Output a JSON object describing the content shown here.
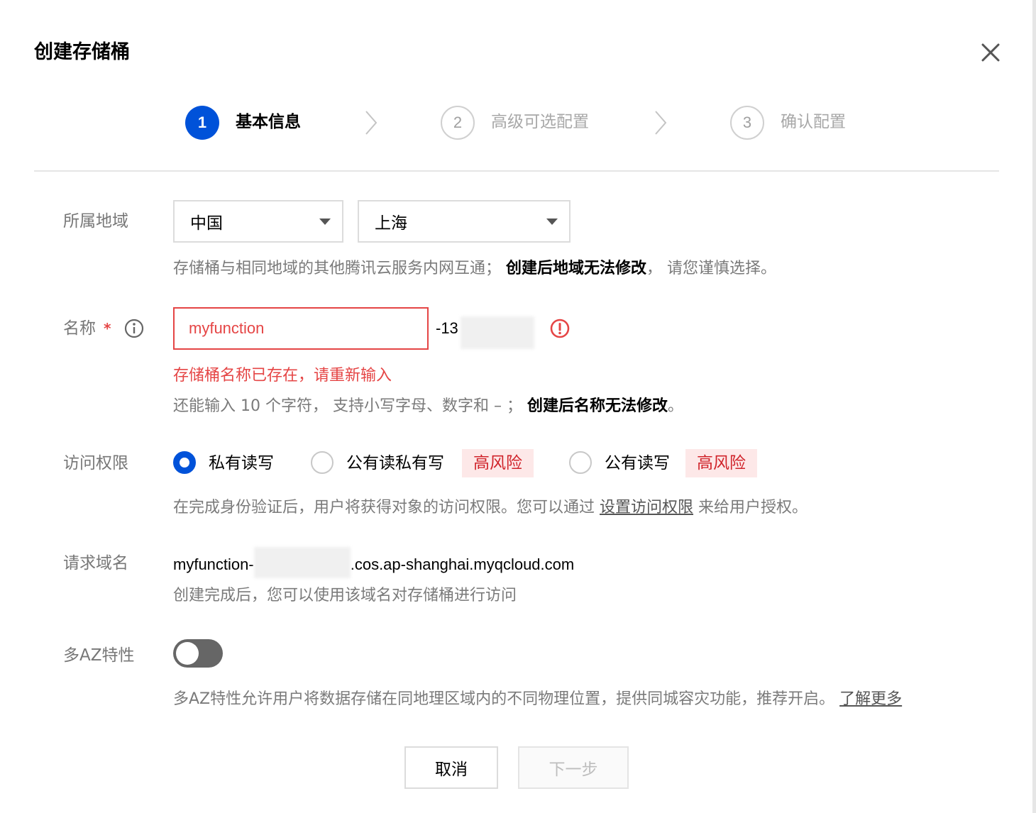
{
  "dialog": {
    "title": "创建存储桶"
  },
  "steps": [
    {
      "number": "1",
      "label": "基本信息",
      "state": "active"
    },
    {
      "number": "2",
      "label": "高级可选配置",
      "state": "idle"
    },
    {
      "number": "3",
      "label": "确认配置",
      "state": "idle"
    }
  ],
  "region": {
    "label": "所属地域",
    "country": "中国",
    "city": "上海",
    "help_prefix": "存储桶与相同地域的其他腾讯云服务内网互通；",
    "help_bold": "创建后地域无法修改",
    "help_suffix": "， 请您谨慎选择。"
  },
  "name": {
    "label": "名称",
    "required_mark": "*",
    "value": "myfunction",
    "suffix": "-13",
    "error": "存储桶名称已存在，请重新输入",
    "help_prefix": "还能输入 10 个字符，  支持小写字母、数字和 – ；",
    "help_bold": "创建后名称无法修改",
    "help_end": "。"
  },
  "access": {
    "label": "访问权限",
    "options": [
      {
        "label": "私有读写",
        "selected": true
      },
      {
        "label": "公有读私有写",
        "selected": false,
        "badge": "高风险"
      },
      {
        "label": "公有读写",
        "selected": false,
        "badge": "高风险"
      }
    ],
    "help_prefix": "在完成身份验证后，用户将获得对象的访问权限。您可以通过",
    "help_link": "设置访问权限",
    "help_suffix": "来给用户授权。"
  },
  "domain": {
    "label": "请求域名",
    "prefix": "myfunction-",
    "suffix": ".cos.ap-shanghai.myqcloud.com",
    "help": "创建完成后，您可以使用该域名对存储桶进行访问"
  },
  "multi_az": {
    "label": "多AZ特性",
    "enabled": false,
    "help": "多AZ特性允许用户将数据存储在同地理区域内的不同物理位置，提供同城容灾功能，推荐开启。",
    "help_link": "了解更多"
  },
  "buttons": {
    "cancel": "取消",
    "next": "下一步"
  },
  "colors": {
    "primary": "#0052d9",
    "error": "#e54545",
    "risk_bg": "#fde8e8",
    "risk_text": "#d0232a"
  }
}
